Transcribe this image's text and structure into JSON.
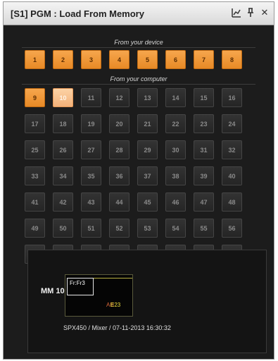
{
  "window": {
    "title": "[S1] PGM : Load From Memory"
  },
  "title_icons": [
    "chart-icon",
    "pin-icon",
    "close-icon"
  ],
  "device_section": {
    "label": "From your device",
    "buttons": [
      "1",
      "2",
      "3",
      "4",
      "5",
      "6",
      "7",
      "8"
    ]
  },
  "computer_section": {
    "label": "From your computer",
    "selected": "10",
    "buttons": [
      "9",
      "10",
      "11",
      "12",
      "13",
      "14",
      "15",
      "16",
      "17",
      "18",
      "19",
      "20",
      "21",
      "22",
      "23",
      "24",
      "25",
      "26",
      "27",
      "28",
      "29",
      "30",
      "31",
      "32",
      "33",
      "34",
      "35",
      "36",
      "37",
      "38",
      "39",
      "40",
      "41",
      "42",
      "43",
      "44",
      "45",
      "46",
      "47",
      "48",
      "49",
      "50",
      "51",
      "52",
      "53",
      "54",
      "55",
      "56",
      "57",
      "58",
      "59",
      "60",
      "61",
      "62",
      "63",
      "64"
    ]
  },
  "preview": {
    "label": "MM 10",
    "frame_label": "Fr:Fr3",
    "ab_label": "AB",
    "e_label": "E23",
    "caption": "SPX450 / Mixer / 07-11-2013 16:30:32"
  },
  "colors": {
    "accent": "#f0963a",
    "selected": "#f8c08c",
    "background": "#1c1c1c"
  }
}
